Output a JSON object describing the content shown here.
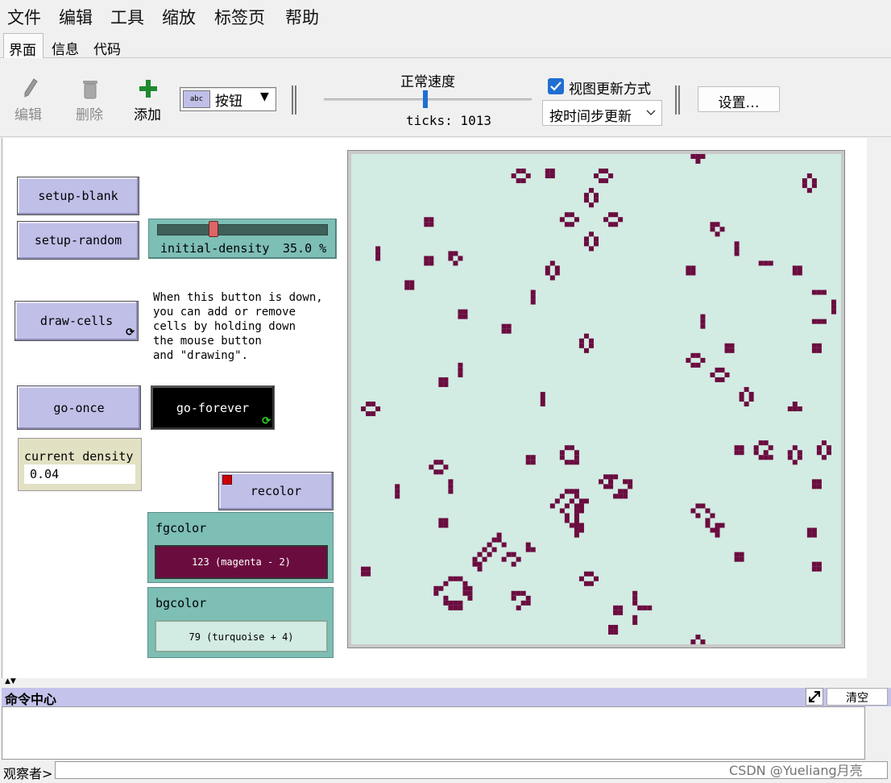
{
  "menu": [
    "文件",
    "编辑",
    "工具",
    "缩放",
    "标签页",
    "帮助"
  ],
  "tabs": [
    {
      "label": "界面",
      "active": true
    },
    {
      "label": "信息",
      "active": false
    },
    {
      "label": "代码",
      "active": false
    }
  ],
  "toolbar": {
    "edit_label": "编辑",
    "delete_label": "删除",
    "add_label": "添加",
    "widget_type": "按钮",
    "speed_label": "正常速度",
    "ticks": "ticks: 1013",
    "view_update_label": "视图更新方式",
    "view_update_checked": true,
    "update_mode": "按时间步更新",
    "settings_label": "设置…"
  },
  "widgets": {
    "setup_blank": "setup-blank",
    "setup_random": "setup-random",
    "slider": {
      "name": "initial-density",
      "value": "35.0 %",
      "fraction": 0.35
    },
    "draw_cells": "draw-cells",
    "note_lines": [
      "When this button is down,",
      "you can add or remove",
      "cells by holding down",
      "the mouse button",
      "and \"drawing\"."
    ],
    "go_once": "go-once",
    "go_forever": "go-forever",
    "monitor": {
      "label": "current density",
      "value": "0.04"
    },
    "recolor": "recolor",
    "fgcolor": {
      "label": "fgcolor",
      "value": "123 (magenta - 2)",
      "color": "#6b0c3f"
    },
    "bgcolor": {
      "label": "bgcolor",
      "value": "79 (turquoise + 4)",
      "color": "#d2ebe3"
    }
  },
  "world": {
    "cell_color": "#6b0c3f",
    "background": "#d2ebe3"
  },
  "command_center": {
    "title": "命令中心",
    "clear_label": "清空",
    "observer_label": "观察者>"
  },
  "watermark": "CSDN @Yueliang月亮"
}
